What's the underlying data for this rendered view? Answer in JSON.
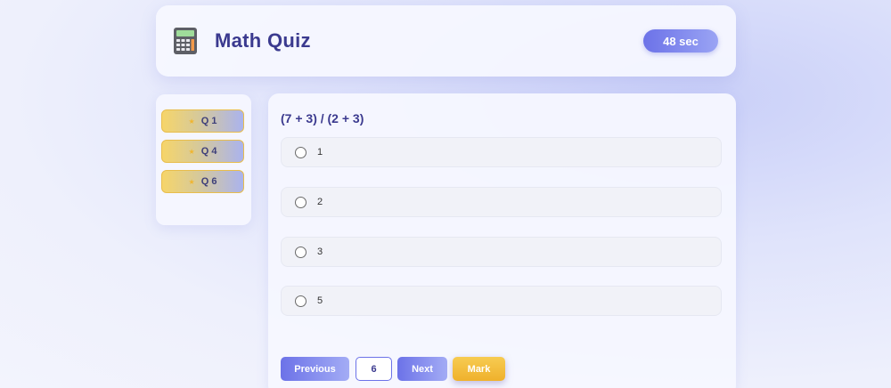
{
  "header": {
    "icon": "calculator-icon",
    "title": "Math Quiz",
    "timer": "48 sec"
  },
  "sidebar": {
    "items": [
      {
        "label": "Q 1",
        "icon": "star-icon"
      },
      {
        "label": "Q 4",
        "icon": "star-icon"
      },
      {
        "label": "Q 6",
        "icon": "star-icon"
      }
    ]
  },
  "question": {
    "text": "(7 + 3) / (2 + 3)",
    "options": [
      "1",
      "2",
      "3",
      "5"
    ]
  },
  "navigation": {
    "previous_label": "Previous",
    "page_number": "6",
    "next_label": "Next",
    "mark_label": "Mark"
  },
  "colors": {
    "accent": "#6c72e8",
    "title": "#3b3a8f",
    "mark": "#f2b935"
  }
}
